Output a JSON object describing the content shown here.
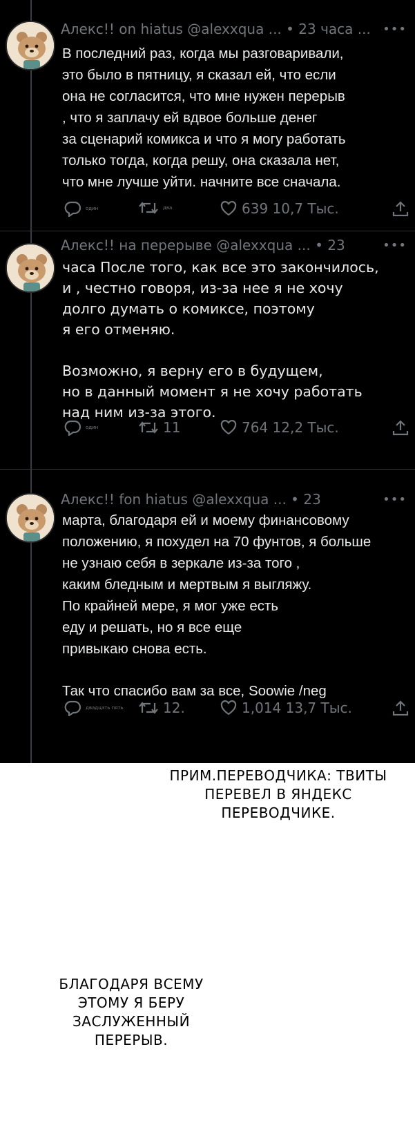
{
  "tweets": [
    {
      "header": "Алекс!! on hiatus @alexxqua ... • 23 часа ...",
      "lines": [
        "В последний раз, когда мы разговаривали,",
        "это было в пятницу, я сказал ей, что если",
        "она не согласится, что мне нужен перерыв",
        ", что я заплачу ей вдвое больше денег",
        "за сценарий комикса и что я могу работать",
        "только тогда, когда решу, она сказала нет,",
        "что мне лучше уйти. начните все сначала."
      ],
      "reply_label": "один",
      "retweet_label": "двa",
      "like_count": "639 10,7 Тыс."
    },
    {
      "header": "Алекс!! на перерыве @alexxqua ... • 23",
      "lines": [
        "часа После того, как все это закончилось,",
        "и , честно говоря, из-за нее я не хочу",
        "долго думать о комиксе, поэтому",
        "я его отменяю.",
        "",
        "Возможно, я верну его в будущем,",
        "но в данный момент я не хочу работать",
        "над ним из-за этого."
      ],
      "reply_label": "один",
      "retweet_label": "11",
      "like_count": "764 12,2 Тыс."
    },
    {
      "header": "Алекс!! fon hiatus @alexxqua ... • 23",
      "lines": [
        "марта, благодаря ей и моему финансовому",
        "положению, я похудел на 70 фунтов, я больше",
        "не узнаю себя в зеркале из-за того ,",
        "каким бледным и мертвым я выгляжу.",
        "По крайней мере, я мог уже есть",
        "еду и решать, но я все еще",
        "привыкаю снова есть.",
        "",
        "Так что спасибо вам за все, Soowie /neg"
      ],
      "reply_label": "двадцать пять",
      "retweet_label": "12.",
      "like_count": "1,014 13,7 Тыс."
    }
  ],
  "translator_note": [
    "ПРИМ.ПЕРЕВОДЧИКА: ТВИТЫ",
    "ПЕРЕВЕЛ В ЯНДЕКС",
    "ПЕРЕВОДЧИКЕ."
  ],
  "speech_bubble": [
    "БЛАГОДАРЯ ВСЕМУ",
    "ЭТОМУ Я БЕРУ",
    "ЗАСЛУЖЕННЫЙ",
    "ПЕРЕРЫВ."
  ],
  "colors": {
    "background": "#000000",
    "text": "#e7e9ea",
    "muted": "#71767b",
    "divider": "#2f3336"
  },
  "icons": [
    "reply-icon",
    "retweet-icon",
    "like-icon",
    "share-icon",
    "avatar-bear"
  ]
}
